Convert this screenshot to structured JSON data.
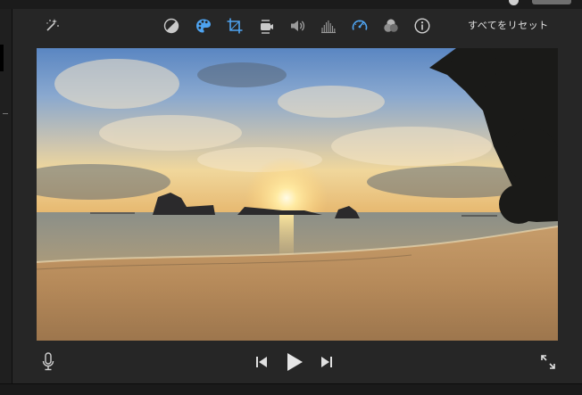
{
  "toolbar": {
    "reset_label": "すべてをリセット",
    "tools": [
      {
        "name": "auto-enhance-icon"
      },
      {
        "name": "color-balance-icon"
      },
      {
        "name": "color-correction-icon",
        "active": true
      },
      {
        "name": "crop-icon"
      },
      {
        "name": "stabilization-icon"
      },
      {
        "name": "volume-icon"
      },
      {
        "name": "noise-reduction-icon"
      },
      {
        "name": "speed-icon"
      },
      {
        "name": "clip-filter-icon"
      },
      {
        "name": "info-icon"
      }
    ]
  },
  "colors": {
    "accent": "#4ea3f0",
    "icon": "#c9c9c9",
    "background": "#262626"
  },
  "viewer": {
    "content": "sunset-beach-video-frame"
  },
  "controls": {
    "left": [
      "microphone-icon"
    ],
    "center": [
      "skip-back-icon",
      "play-icon",
      "skip-forward-icon"
    ],
    "right": [
      "fullscreen-icon"
    ]
  }
}
